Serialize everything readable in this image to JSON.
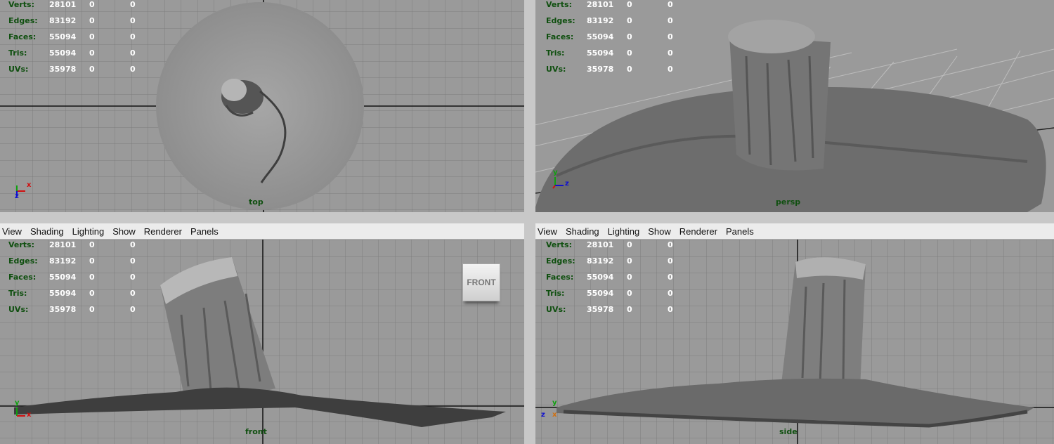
{
  "menu": [
    "View",
    "Shading",
    "Lighting",
    "Show",
    "Renderer",
    "Panels"
  ],
  "stats": [
    {
      "label": "Verts:",
      "v1": "28101",
      "v2": "0",
      "v3": "0"
    },
    {
      "label": "Edges:",
      "v1": "83192",
      "v2": "0",
      "v3": "0"
    },
    {
      "label": "Faces:",
      "v1": "55094",
      "v2": "0",
      "v3": "0"
    },
    {
      "label": "Tris:",
      "v1": "55094",
      "v2": "0",
      "v3": "0"
    },
    {
      "label": "UVs:",
      "v1": "35978",
      "v2": "0",
      "v3": "0"
    }
  ],
  "viewports": {
    "top": {
      "camera": "top",
      "axes": [
        "x",
        "z"
      ]
    },
    "persp": {
      "camera": "persp",
      "axes": [
        "y",
        "z"
      ]
    },
    "front": {
      "camera": "front",
      "cube": "FRONT",
      "axes": [
        "y",
        "x"
      ]
    },
    "side": {
      "camera": "side",
      "axes": [
        "y",
        "z",
        "x"
      ]
    }
  },
  "colors": {
    "viewport_bg": "#9a9a9a",
    "grid": "#7d7d7d",
    "stat_label": "#0f4f0f",
    "stat_value": "#ffffff",
    "axis_x": "#d01010",
    "axis_y": "#10a010",
    "axis_z": "#1010d0"
  }
}
